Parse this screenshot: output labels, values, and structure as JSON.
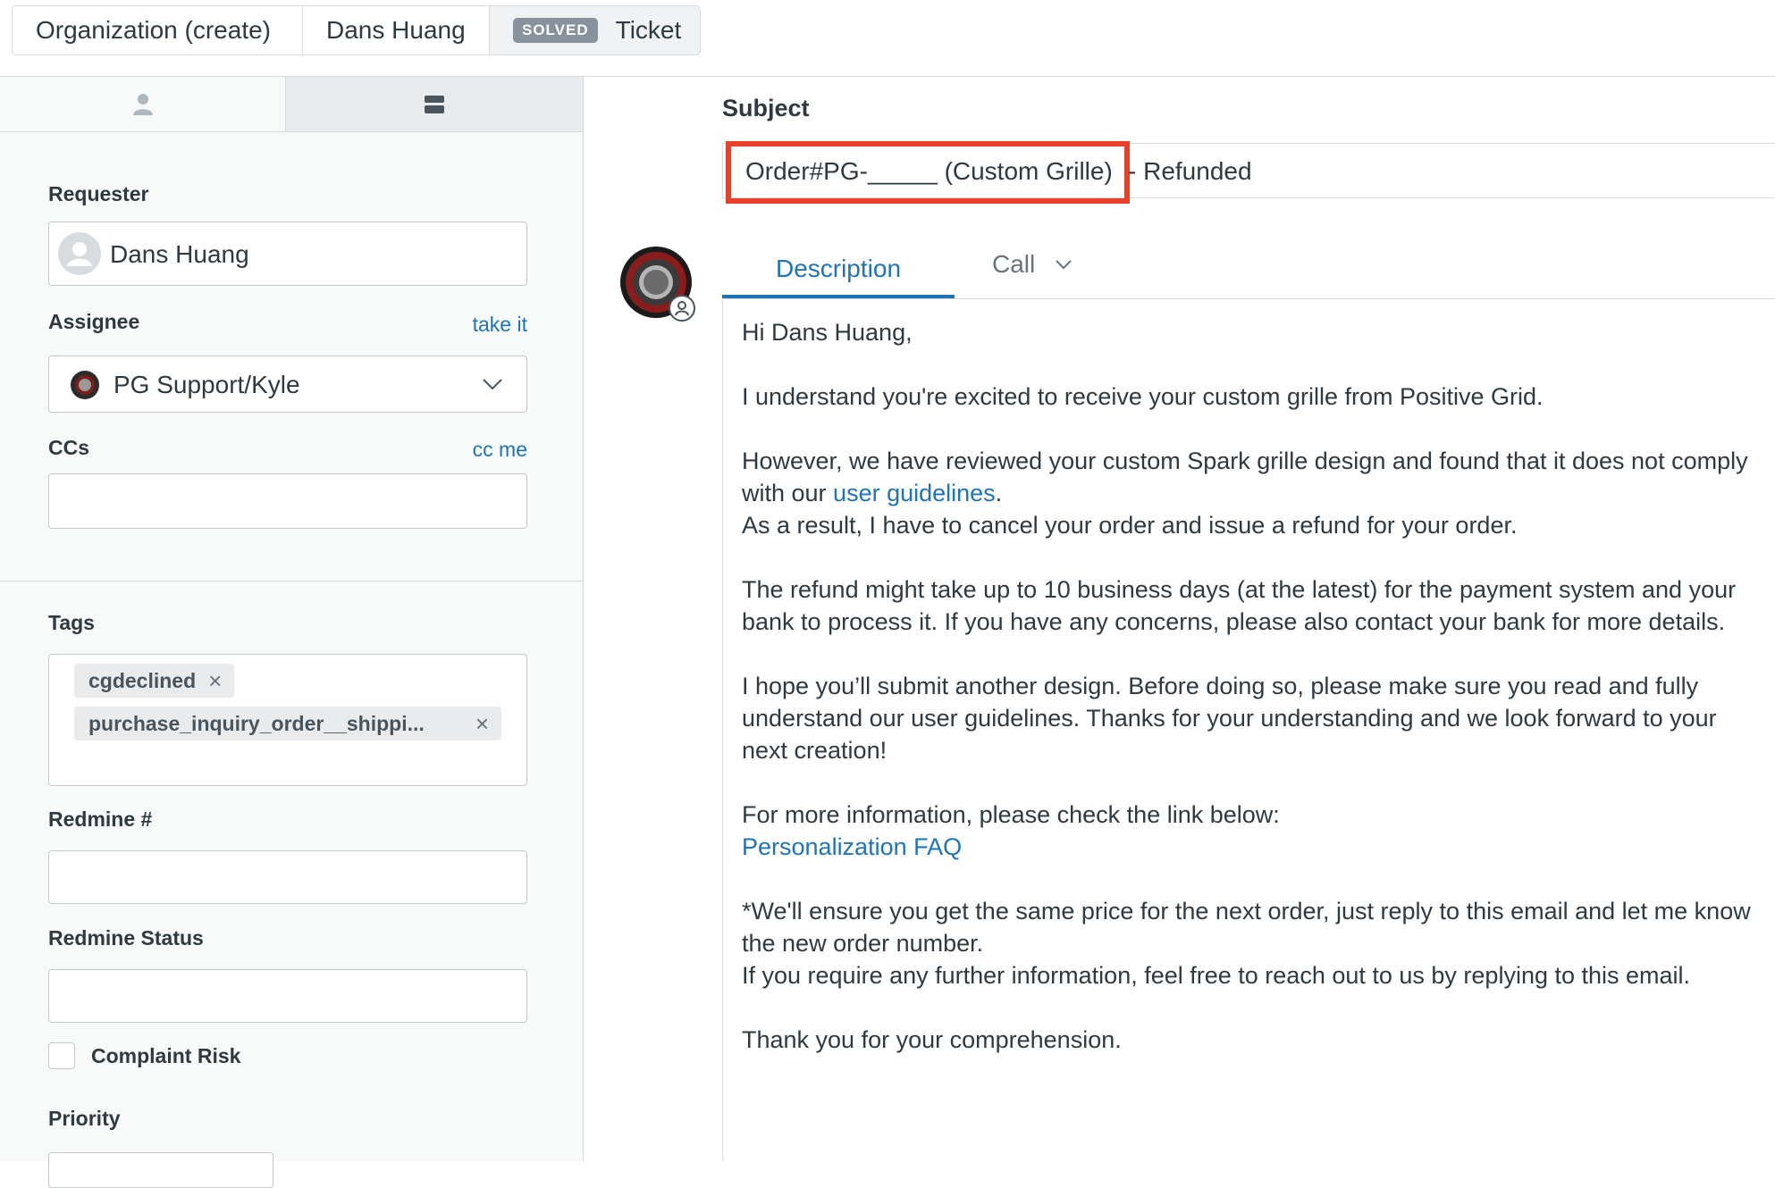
{
  "tabs": {
    "organization": "Organization (create)",
    "requester_tab": "Dans Huang",
    "ticket_badge": "SOLVED",
    "ticket_label": "Ticket"
  },
  "icons": {
    "user_tab": "user-icon",
    "ticket_tab": "ticket-icon"
  },
  "fields": {
    "requester_label": "Requester",
    "requester_value": "Dans Huang",
    "assignee_label": "Assignee",
    "take_it": "take it",
    "assignee_value": "PG Support/Kyle",
    "ccs_label": "CCs",
    "cc_me": "cc me",
    "tags_label": "Tags",
    "tags": [
      "cgdeclined",
      "purchase_inquiry_order__shippi..."
    ],
    "redmine_label": "Redmine #",
    "redmine_status_label": "Redmine Status",
    "complaint_risk_label": "Complaint Risk",
    "priority_label": "Priority"
  },
  "subject": {
    "label": "Subject",
    "highlighted": "Order#PG-_____ (Custom Grille)",
    "rest": "- Refunded",
    "highlight_color": "#e8402a"
  },
  "message_tabs": {
    "description": "Description",
    "call": "Call"
  },
  "message": {
    "greeting": "Hi Dans Huang,",
    "p1": "I understand you're excited to receive your custom grille from Positive Grid.",
    "p2a": "However, we have reviewed your custom Spark grille design and found that it does not comply with our ",
    "p2_link": "user guidelines",
    "p2b": ".",
    "p2c": "As a result, I have to cancel your order and issue a refund for your order.",
    "p3": "The refund might take up to 10 business days (at the latest) for the payment system and your bank to process it. If you have any concerns, please also contact your bank for more details.",
    "p4": "I hope you’ll submit another design. Before doing so, please make sure you read and fully understand our user guidelines. Thanks for your understanding and we look forward to your next creation!",
    "p5": "For more information, please check the link below:",
    "p5_link": "Personalization FAQ",
    "p6a": "*We'll ensure you get the same price for the next order, just reply to this email and let me know the new order number.",
    "p6b": "If you require any further information, feel free to reach out to us by replying to this email.",
    "p7": "Thank you for your comprehension."
  },
  "colors": {
    "link": "#1f73b7",
    "active_tab": "#1f73b7",
    "badge": "#87929d"
  }
}
